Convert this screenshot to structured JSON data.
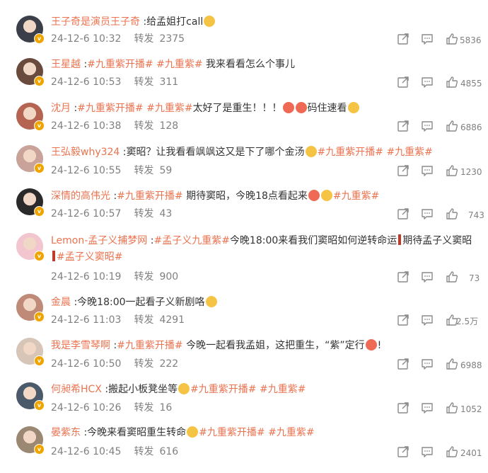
{
  "comments": [
    {
      "user": "王子奇是演员王子奇",
      "parts": [
        {
          "t": "text",
          "v": " :给孟姐打call"
        },
        {
          "t": "emo",
          "c": "yellow"
        }
      ],
      "date": "24-12-6 10:32",
      "repost_label": "转发",
      "reposts": "2375",
      "likes": "5836"
    },
    {
      "user": "王星越",
      "parts": [
        {
          "t": "text",
          "v": " :"
        },
        {
          "t": "topic",
          "v": "#九重紫开播#"
        },
        {
          "t": "text",
          "v": " "
        },
        {
          "t": "topic",
          "v": "#九重紫#"
        },
        {
          "t": "text",
          "v": " 我来看看怎么个事儿"
        }
      ],
      "date": "24-12-6 10:53",
      "repost_label": "转发",
      "reposts": "311",
      "likes": "4855"
    },
    {
      "user": "沈月",
      "parts": [
        {
          "t": "text",
          "v": " :"
        },
        {
          "t": "topic",
          "v": "#九重紫开播#"
        },
        {
          "t": "text",
          "v": " "
        },
        {
          "t": "topic",
          "v": "#九重紫#"
        },
        {
          "t": "text",
          "v": "太好了是重生！！！"
        },
        {
          "t": "emo",
          "c": "red"
        },
        {
          "t": "emo",
          "c": "red"
        },
        {
          "t": "text",
          "v": "码住速看"
        },
        {
          "t": "emo",
          "c": "yellow"
        }
      ],
      "date": "24-12-6 10:38",
      "repost_label": "转发",
      "reposts": "128",
      "likes": "6886"
    },
    {
      "user": "王弘毅why324",
      "parts": [
        {
          "t": "text",
          "v": " :窦昭？让我看看飒飒这又是下了哪个金汤"
        },
        {
          "t": "emo",
          "c": "yellow"
        },
        {
          "t": "topic",
          "v": "#九重紫开播#"
        },
        {
          "t": "text",
          "v": " "
        },
        {
          "t": "topic",
          "v": "#九重紫#"
        }
      ],
      "date": "24-12-6 10:55",
      "repost_label": "转发",
      "reposts": "59",
      "likes": "1230"
    },
    {
      "user": "深情的高伟光",
      "parts": [
        {
          "t": "text",
          "v": " :"
        },
        {
          "t": "topic",
          "v": "#九重紫开播#"
        },
        {
          "t": "text",
          "v": " 期待窦昭，今晚18点看起来"
        },
        {
          "t": "emo",
          "c": "red"
        },
        {
          "t": "emo",
          "c": "yellow"
        },
        {
          "t": "topic",
          "v": "#九重紫#"
        }
      ],
      "date": "24-12-6 10:57",
      "repost_label": "转发",
      "reposts": "43",
      "likes": "743"
    },
    {
      "user": "Lemon-孟子义捕梦网",
      "parts": [
        {
          "t": "text",
          "v": " :"
        },
        {
          "t": "topic",
          "v": "#孟子义九重紫#"
        },
        {
          "t": "text",
          "v": "今晚18:00来看我们窦昭如何逆转命运"
        },
        {
          "t": "bar"
        },
        {
          "t": "text",
          "v": "期待孟子义窦昭"
        },
        {
          "t": "bar"
        },
        {
          "t": "topic",
          "v": "#孟子义窦昭#"
        }
      ],
      "date": "24-12-6 10:19",
      "repost_label": "转发",
      "reposts": "900",
      "likes": "73"
    },
    {
      "user": "金晨",
      "parts": [
        {
          "t": "text",
          "v": " :今晚18:00一起看子义新剧咯"
        },
        {
          "t": "emo",
          "c": "yellow"
        }
      ],
      "date": "24-12-6 11:03",
      "repost_label": "转发",
      "reposts": "4291",
      "likes": "2.5万"
    },
    {
      "user": "我是李雪琴啊",
      "parts": [
        {
          "t": "text",
          "v": " :"
        },
        {
          "t": "topic",
          "v": "#九重紫开播#"
        },
        {
          "t": "text",
          "v": " 今晚一起看我孟姐，这把重生，“紫”定行"
        },
        {
          "t": "emo",
          "c": "red"
        },
        {
          "t": "text",
          "v": "!"
        }
      ],
      "date": "24-12-6 10:50",
      "repost_label": "转发",
      "reposts": "222",
      "likes": "6988"
    },
    {
      "user": "何昶希HCX",
      "parts": [
        {
          "t": "text",
          "v": " :搬起小板凳坐等"
        },
        {
          "t": "emo",
          "c": "yellow"
        },
        {
          "t": "topic",
          "v": "#九重紫开播#"
        },
        {
          "t": "text",
          "v": " "
        },
        {
          "t": "topic",
          "v": "#九重紫#"
        }
      ],
      "date": "24-12-6 10:26",
      "repost_label": "转发",
      "reposts": "16",
      "likes": "1052"
    },
    {
      "user": "晏紫东",
      "parts": [
        {
          "t": "text",
          "v": " :今晚来看窦昭重生转命"
        },
        {
          "t": "emo",
          "c": "yellow"
        },
        {
          "t": "topic",
          "v": "#九重紫开播#"
        },
        {
          "t": "text",
          "v": " "
        },
        {
          "t": "topic",
          "v": "#九重紫#"
        }
      ],
      "date": "24-12-6 10:45",
      "repost_label": "转发",
      "reposts": "616",
      "likes": "2401"
    }
  ],
  "icons": {
    "share": "share-icon",
    "comment": "comment-icon",
    "like": "thumbs-up-icon",
    "verified": "verified-badge-icon"
  },
  "colors": {
    "username": "#eb7350",
    "topic": "#eb7350",
    "meta": "#808080",
    "text": "#333333",
    "verified": "#f0a400"
  }
}
